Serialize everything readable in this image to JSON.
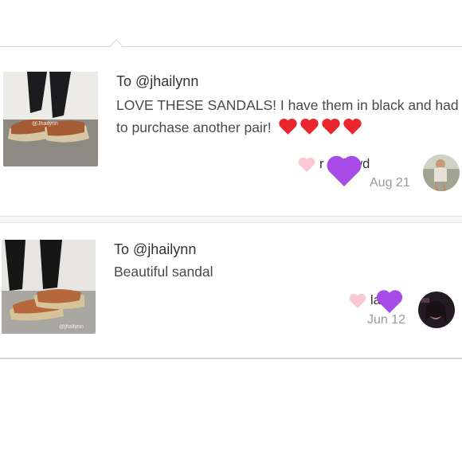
{
  "comments": [
    {
      "to": "To @jhailynn",
      "text": "LOVE THESE SANDALS! I have them in black and had to purchase another pair!",
      "emoji": "red-heart-icon",
      "emoji_count": 4,
      "username": "r mdowd",
      "date": "Aug 21",
      "watermark": "@Jhailynn"
    },
    {
      "to": "To @jhailynn",
      "text": "Beautiful sandal",
      "username": "la 3",
      "date": "Jun 12",
      "watermark": "@jhailynn"
    }
  ],
  "colors": {
    "like_heart": "#f9c9d3",
    "red_heart": "#e8262b",
    "purple_heart": "#a64be6",
    "date_text": "#9a9a9a"
  }
}
